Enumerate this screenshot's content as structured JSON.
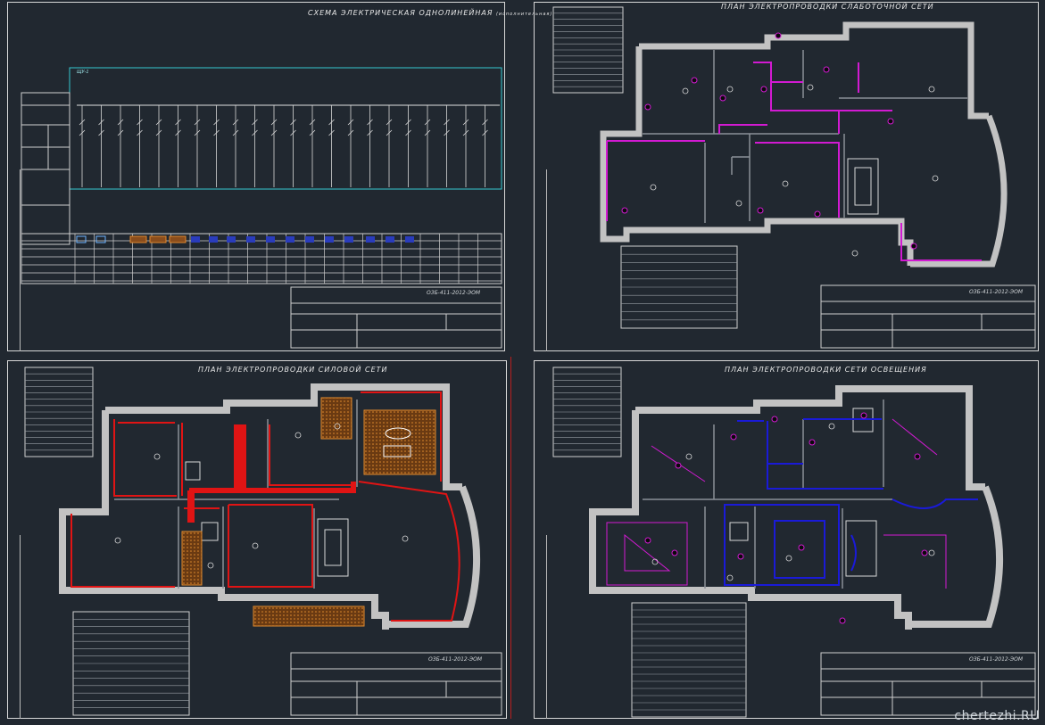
{
  "sheets": {
    "schematic": {
      "title": "СХЕМА ЭЛЕКТРИЧЕСКАЯ ОДНОЛИНЕЙНАЯ",
      "title_suffix": "(исполнительная)",
      "panel": "ЩУ-1",
      "doc_code": "ОЗБ-411-2012-ЭОМ"
    },
    "low_current": {
      "title": "ПЛАН ЭЛЕКТРОПРОВОДКИ СЛАБОТОЧНОЙ СЕТИ",
      "doc_code": "ОЗБ-411-2012-ЭОМ"
    },
    "power": {
      "title": "ПЛАН ЭЛЕКТРОПРОВОДКИ СИЛОВОЙ СЕТИ",
      "doc_code": "ОЗБ-411-2012-ЭОМ"
    },
    "lighting": {
      "title": "ПЛАН ЭЛЕКТРОПРОВОДКИ СЕТИ ОСВЕЩЕНИЯ",
      "doc_code": "ОЗБ-411-2012-ЭОМ"
    }
  },
  "watermark": "chertezhi.RU",
  "colors": {
    "background": "#212830",
    "frame": "#d8d8d8",
    "wall": "#c2c2c2",
    "low_current": "#d21ad2",
    "power": "#e01414",
    "lighting": "#1a1ad8",
    "schematic_box": "#35c8d0",
    "hatch": "#d9822b"
  }
}
